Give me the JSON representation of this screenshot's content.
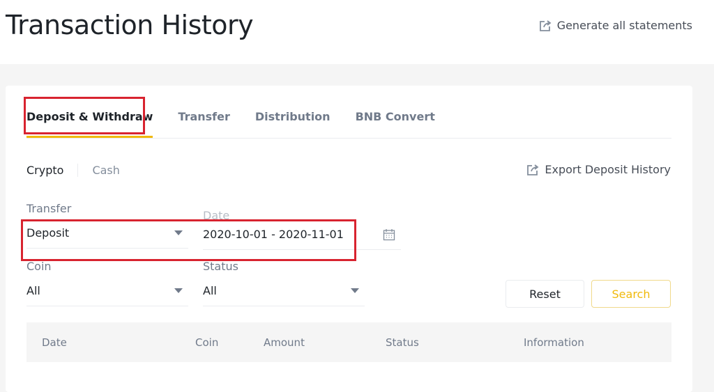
{
  "header": {
    "title": "Transaction History",
    "generate_label": "Generate all statements"
  },
  "tabs": [
    {
      "label": "Deposit & Withdraw",
      "active": true
    },
    {
      "label": "Transfer"
    },
    {
      "label": "Distribution"
    },
    {
      "label": "BNB Convert"
    }
  ],
  "subtabs": {
    "crypto": "Crypto",
    "cash": "Cash"
  },
  "export_label": "Export Deposit History",
  "filters": {
    "transfer": {
      "label": "Transfer",
      "value": "Deposit"
    },
    "date": {
      "label": "Date",
      "value": "2020-10-01 - 2020-11-01"
    },
    "coin": {
      "label": "Coin",
      "value": "All"
    },
    "status": {
      "label": "Status",
      "value": "All"
    }
  },
  "buttons": {
    "reset": "Reset",
    "search": "Search"
  },
  "table": {
    "columns": [
      "Date",
      "Coin",
      "Amount",
      "Status",
      "Information"
    ]
  },
  "colors": {
    "accent": "#f0b90b",
    "highlight": "#d8232f"
  }
}
